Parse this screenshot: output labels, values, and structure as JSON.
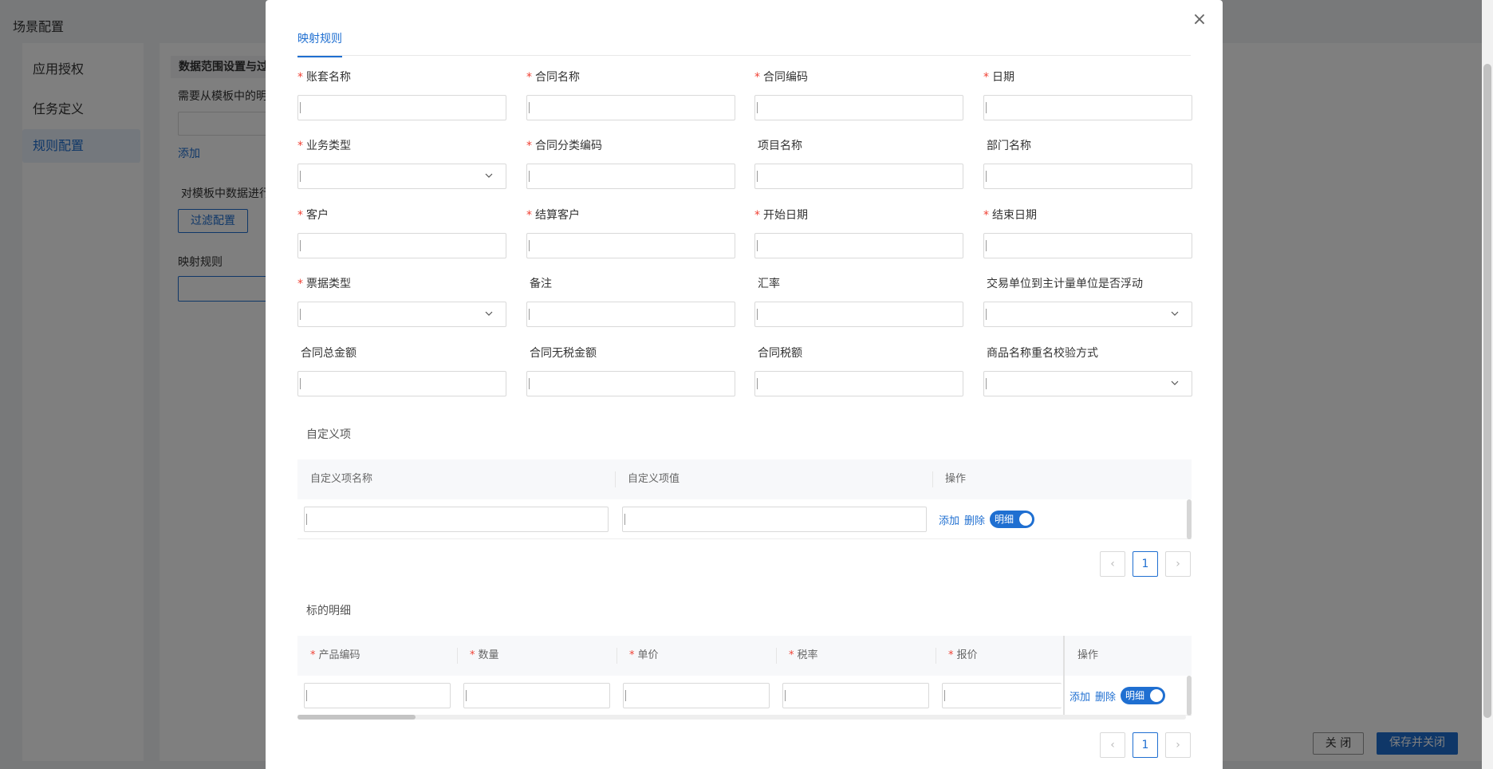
{
  "background": {
    "title": "场景配置",
    "nav": [
      {
        "label": "应用授权"
      },
      {
        "label": "任务定义"
      },
      {
        "label": "规则配置"
      }
    ],
    "section_header": "数据范围设置与过",
    "hint_text": "需要从模板中的明",
    "add_link": "添加",
    "filter_hint": "对模板中数据进行",
    "filter_button": "过滤配置",
    "mapping_label": "映射规则",
    "close_button": "关 闭",
    "save_close_button": "保存并关闭"
  },
  "modal": {
    "close_glyph": "×",
    "tab": "映射规则",
    "fields": [
      {
        "label": "账套名称",
        "required": "*",
        "type": "input"
      },
      {
        "label": "合同名称",
        "required": "*",
        "type": "input"
      },
      {
        "label": "合同编码",
        "required": "*",
        "type": "input"
      },
      {
        "label": "日期",
        "required": "*",
        "type": "input"
      },
      {
        "label": "业务类型",
        "required": "*",
        "type": "select"
      },
      {
        "label": "合同分类编码",
        "required": "*",
        "type": "input"
      },
      {
        "label": "项目名称",
        "required": "",
        "type": "input"
      },
      {
        "label": "部门名称",
        "required": "",
        "type": "input"
      },
      {
        "label": "客户",
        "required": "*",
        "type": "input"
      },
      {
        "label": "结算客户",
        "required": "*",
        "type": "input"
      },
      {
        "label": "开始日期",
        "required": "*",
        "type": "input"
      },
      {
        "label": "结束日期",
        "required": "*",
        "type": "input"
      },
      {
        "label": "票据类型",
        "required": "*",
        "type": "select"
      },
      {
        "label": "备注",
        "required": "",
        "type": "input"
      },
      {
        "label": "汇率",
        "required": "",
        "type": "input"
      },
      {
        "label": "交易单位到主计量单位是否浮动",
        "required": "",
        "type": "select"
      },
      {
        "label": "合同总金额",
        "required": "",
        "type": "input"
      },
      {
        "label": "合同无税金额",
        "required": "",
        "type": "input"
      },
      {
        "label": "合同税额",
        "required": "",
        "type": "input"
      },
      {
        "label": "商品名称重名校验方式",
        "required": "",
        "type": "select"
      }
    ],
    "custom_section": {
      "title": "自定义项",
      "columns": [
        "自定义项名称",
        "自定义项值",
        "操作"
      ],
      "row": {
        "add": "添加",
        "delete": "删除",
        "switch_label": "明细"
      },
      "pager": {
        "prev": "‹",
        "page": "1",
        "next": "›"
      }
    },
    "detail_section": {
      "title": "标的明细",
      "columns": [
        {
          "label": "产品编码",
          "required": "*"
        },
        {
          "label": "数量",
          "required": "*"
        },
        {
          "label": "单价",
          "required": "*"
        },
        {
          "label": "税率",
          "required": "*"
        },
        {
          "label": "报价",
          "required": "*"
        },
        {
          "label": "操作",
          "required": ""
        }
      ],
      "row": {
        "add": "添加",
        "delete": "删除",
        "switch_label": "明细"
      },
      "pager": {
        "prev": "‹",
        "page": "1",
        "next": "›"
      }
    }
  }
}
